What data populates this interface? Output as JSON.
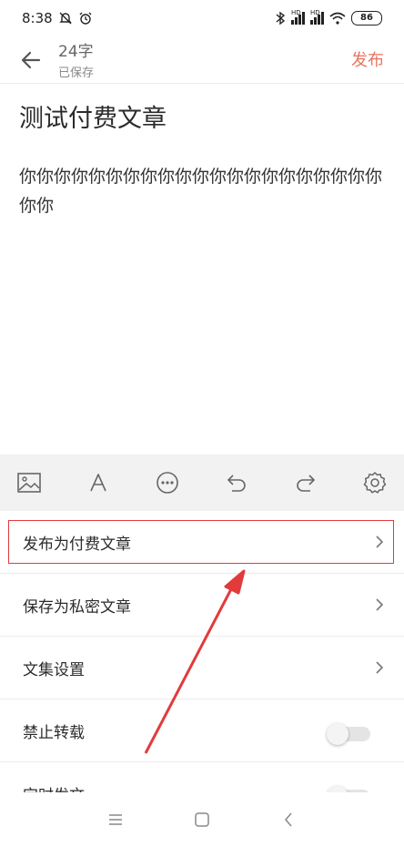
{
  "status_bar": {
    "time": "8:38",
    "battery": "86",
    "network_badge_1": "HD",
    "network_badge_2": "HD"
  },
  "header": {
    "word_count": "24字",
    "save_status": "已保存",
    "publish_label": "发布"
  },
  "editor": {
    "title": "测试付费文章",
    "body": "你你你你你你你你你你你你你你你你你你你你你你你"
  },
  "toolbar": {
    "icons": [
      "image-icon",
      "font-icon",
      "more-icon",
      "undo-icon",
      "redo-icon",
      "settings-icon"
    ]
  },
  "settings": {
    "items": [
      {
        "label": "发布为付费文章",
        "control": "chevron"
      },
      {
        "label": "保存为私密文章",
        "control": "chevron"
      },
      {
        "label": "文集设置",
        "control": "chevron"
      },
      {
        "label": "禁止转载",
        "control": "toggle",
        "value": false
      },
      {
        "label": "定时发文",
        "control": "toggle",
        "value": false
      }
    ]
  },
  "annotation": {
    "color": "#e23b3b"
  },
  "colors": {
    "accent": "#e8745e",
    "toolbar_bg": "#f2f2f2"
  }
}
